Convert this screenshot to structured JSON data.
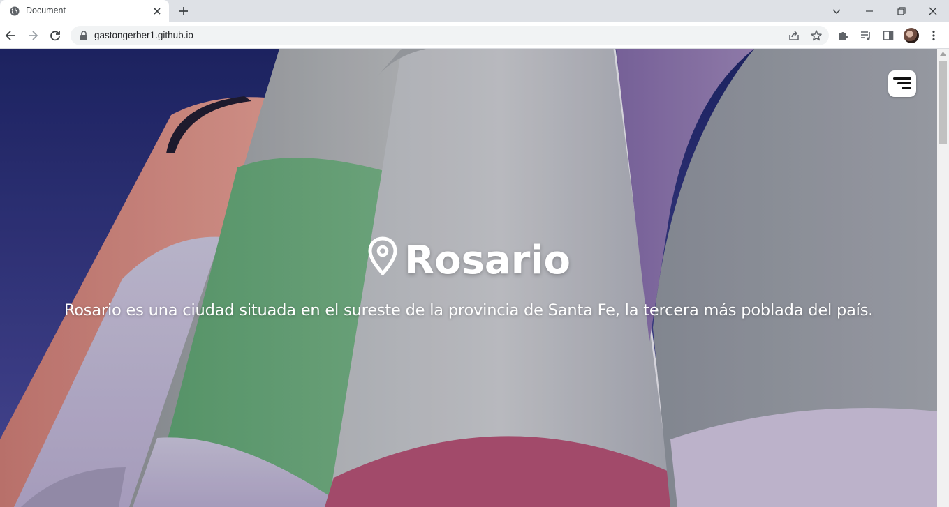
{
  "browser": {
    "tab_title": "Document",
    "url": "gastongerber1.github.io",
    "icons": [
      "globe-icon",
      "close-icon",
      "plus-icon",
      "chevron-down-icon",
      "minimize-icon",
      "restore-icon",
      "close-window-icon",
      "back-icon",
      "forward-icon",
      "reload-icon",
      "lock-icon",
      "share-icon",
      "star-icon",
      "extensions-icon",
      "media-icon",
      "side-panel-icon",
      "avatar",
      "more-icon"
    ]
  },
  "hero": {
    "title": "Rosario",
    "subtitle": "Rosario es una ciudad situada en el sureste de la provincia de Santa Fe, la tercera más poblada del país.",
    "title_icon": "location-pin-icon",
    "menu_icon": "menu-icon"
  },
  "colors": {
    "sky": "#25307a",
    "salmon_silo": "#d98a7c",
    "green_band": "#5fa86e",
    "red_band": "#b0506e",
    "purple_silo": "#8e74a8"
  }
}
